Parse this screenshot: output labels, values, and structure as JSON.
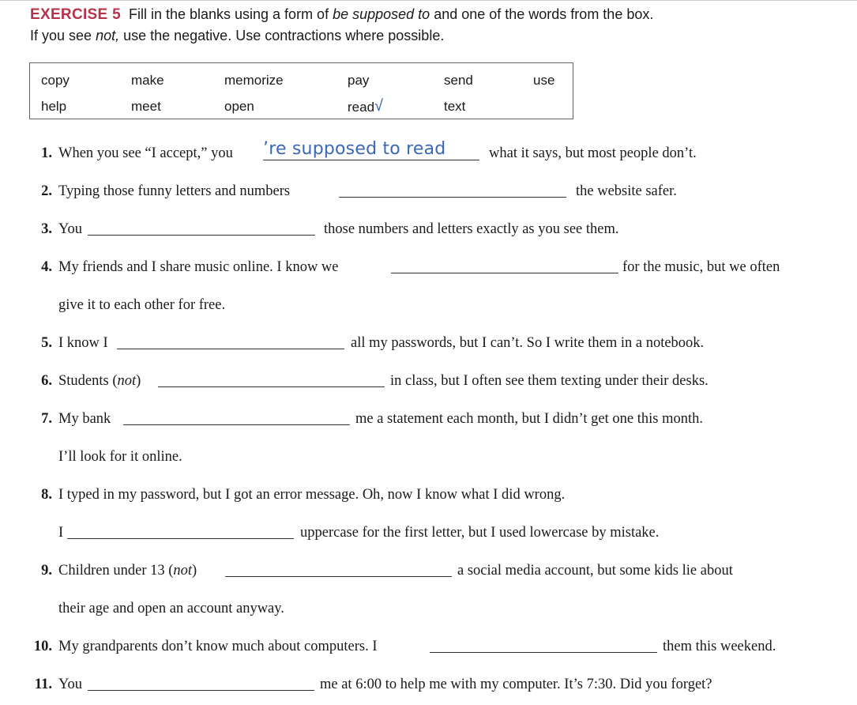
{
  "header": {
    "exercise_label": "EXERCISE 5",
    "instruction_pre": "Fill in the blanks using a form of ",
    "instruction_italic": "be supposed to",
    "instruction_post": " and one of the words from the box.",
    "line2_pre": "If you see ",
    "line2_italic": "not,",
    "line2_post": " use the negative. Use contractions where possible."
  },
  "word_box": {
    "row1": [
      "copy",
      "make",
      "memorize",
      "pay",
      "send",
      "use"
    ],
    "row2": [
      "help",
      "meet",
      "open",
      "read",
      "text"
    ],
    "checked_word": "read",
    "check_mark": "√"
  },
  "items": [
    {
      "num": "1.",
      "pre": "When you see “I accept,” you",
      "answer": "’re supposed to read",
      "post": "what it says, but most people don’t."
    },
    {
      "num": "2.",
      "pre": "Typing those funny letters and numbers",
      "post": "the website safer."
    },
    {
      "num": "3.",
      "pre": "You",
      "post": "those numbers and letters exactly as you see them."
    },
    {
      "num": "4.",
      "pre": "My friends and I share music online. I know we",
      "post": "for the music, but we often",
      "cont": "give it to each other for free."
    },
    {
      "num": "5.",
      "pre": "I know I",
      "post": "all my passwords, but I can’t. So I write them in a notebook."
    },
    {
      "num": "6.",
      "pre": "Students (",
      "pre_italic": "not",
      "pre_close": ")",
      "post": "in class, but I often see them texting under their desks."
    },
    {
      "num": "7.",
      "pre": "My bank",
      "post": "me a statement each month, but I didn’t get one this month.",
      "cont": "I’ll look for it online."
    },
    {
      "num": "8.",
      "pre": "I typed in my password, but I got an error message. Oh, now I know what I did wrong.",
      "cont_pre": "I",
      "cont_post": "uppercase for the first letter, but I used lowercase by mistake."
    },
    {
      "num": "9.",
      "pre": "Children under 13 (",
      "pre_italic": "not",
      "pre_close": ")",
      "post": "a social media account, but some kids lie about",
      "cont": "their age and open an account anyway."
    },
    {
      "num": "10.",
      "pre": "My grandparents don’t know much about computers. I",
      "post": "them this weekend."
    },
    {
      "num": "11.",
      "pre": "You",
      "post": "me at 6:00 to help me with my computer. It’s 7:30. Did you forget?"
    }
  ]
}
